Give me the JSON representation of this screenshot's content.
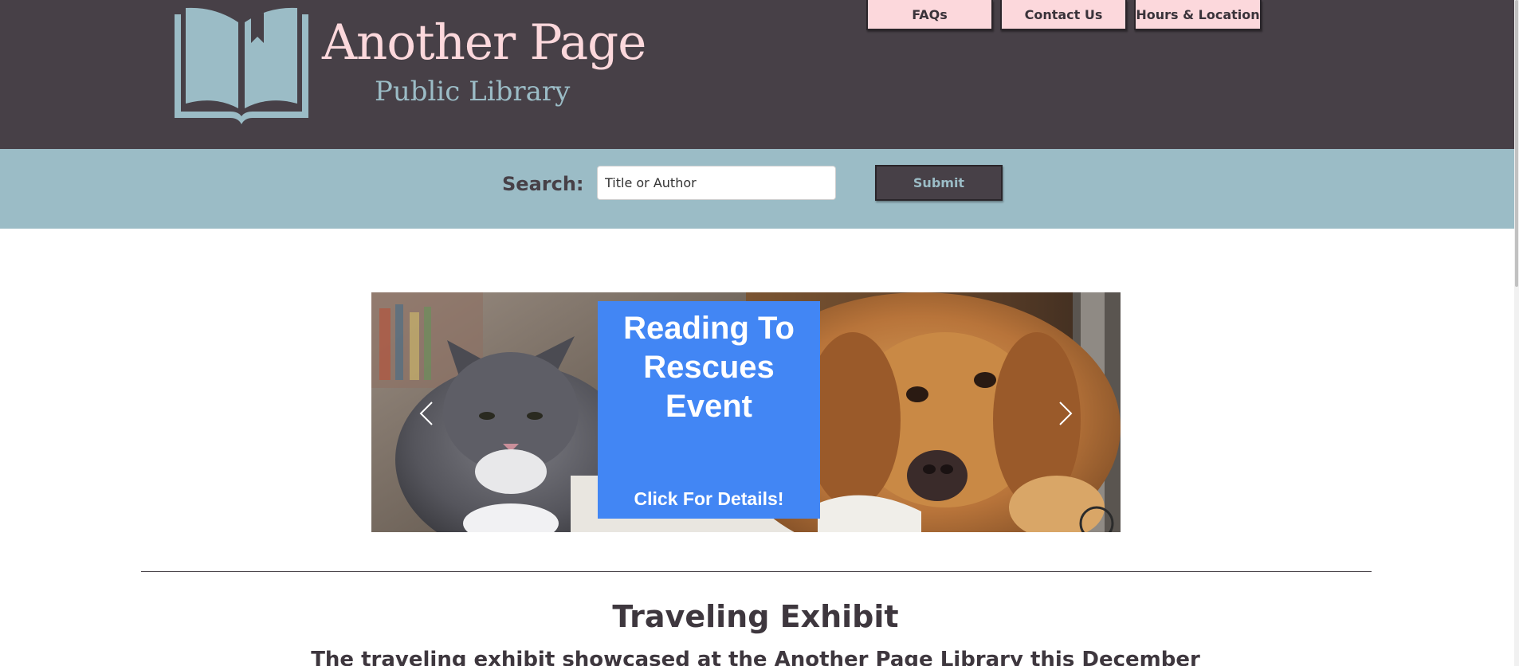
{
  "header": {
    "brand_title": "Another Page",
    "brand_subtitle": "Public Library",
    "logo_icon": "open-book-icon",
    "nav": [
      {
        "label": "FAQs"
      },
      {
        "label": "Contact Us"
      },
      {
        "label": "Hours & Location"
      }
    ]
  },
  "search": {
    "label": "Search:",
    "placeholder": "Title or Author",
    "value": "",
    "submit_label": "Submit"
  },
  "carousel": {
    "prev_icon": "chevron-left-icon",
    "next_icon": "chevron-right-icon",
    "image": "cat-and-dog-photo",
    "promo": {
      "title": "Reading To Rescues Event",
      "cta": "Click For Details!"
    }
  },
  "section": {
    "title": "Traveling Exhibit",
    "text": "The traveling exhibit showcased at the Another Page Library this December"
  },
  "colors": {
    "header_bg": "#474047",
    "accent_pink": "#fcd8dc",
    "accent_blue": "#9bbcc6",
    "promo_blue": "#4286f4"
  }
}
